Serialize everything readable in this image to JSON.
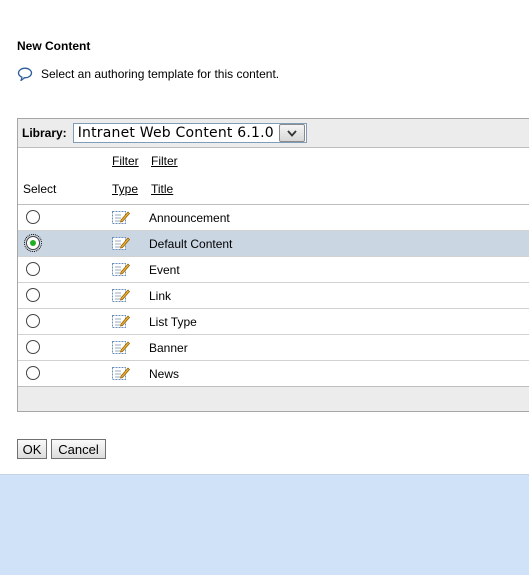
{
  "page": {
    "title": "New Content",
    "instruction": "Select an authoring template for this content."
  },
  "library": {
    "label": "Library:",
    "selected": "Intranet Web Content 6.1.0"
  },
  "columns": {
    "select": "Select",
    "filter_type": "Filter",
    "type": "Type",
    "filter_title": "Filter",
    "title": "Title"
  },
  "templates": [
    {
      "title": "Announcement",
      "selected": false
    },
    {
      "title": "Default Content",
      "selected": true
    },
    {
      "title": "Event",
      "selected": false
    },
    {
      "title": "Link",
      "selected": false
    },
    {
      "title": "List Type",
      "selected": false
    },
    {
      "title": "Banner",
      "selected": false
    },
    {
      "title": "News",
      "selected": false
    }
  ],
  "buttons": {
    "ok": "OK",
    "cancel": "Cancel"
  },
  "icons": {
    "instruction": "speech-bubble-icon",
    "template_type": "edit-document-icon",
    "dropdown": "chevron-down-icon"
  },
  "colors": {
    "selected_row": "#cbd6e3",
    "background": "#cfe2f8",
    "radio_checked": "#20b020"
  }
}
